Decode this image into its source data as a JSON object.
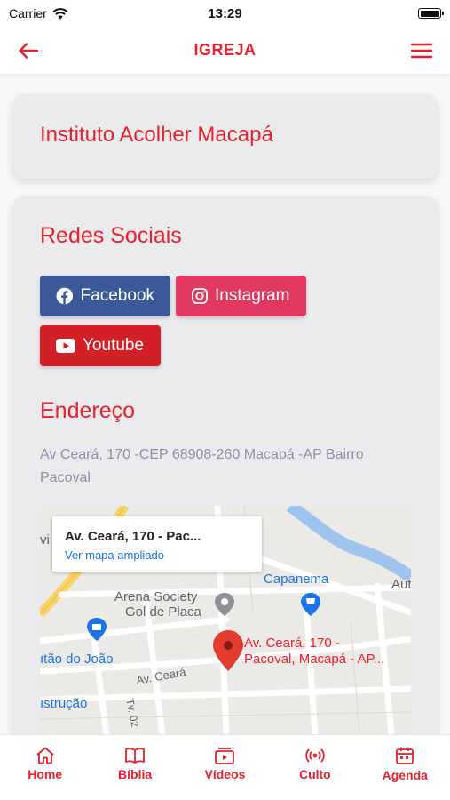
{
  "status": {
    "carrier": "Carrier",
    "time": "13:29"
  },
  "nav": {
    "title": "IGREJA",
    "back_icon": "arrow-left-icon",
    "menu_icon": "hamburger-menu-icon"
  },
  "church": {
    "name": "Instituto Acolher Macapá"
  },
  "social": {
    "title": "Redes Sociais",
    "facebook_label": "Facebook",
    "instagram_label": "Instagram",
    "youtube_label": "Youtube"
  },
  "address": {
    "title": "Endereço",
    "text": "Av Ceará, 170 -CEP 68908-260 Macapá -AP Bairro Pacoval"
  },
  "map": {
    "popup_title": "Av. Ceará, 170 - Pac...",
    "popup_link": "Ver mapa ampliado",
    "labels": {
      "vi": "vi",
      "capanema": "Capanema",
      "aut": "Aut",
      "arena1": "Arena Society",
      "arena2": "Gol de Placa",
      "joao": "ıtão do João",
      "pin1": "Av. Ceará, 170 -",
      "pin2": "Pacoval, Macapá -  AP...",
      "street": "Av. Ceará",
      "construcao": "ıstrução",
      "tv": "Tv. 02"
    }
  },
  "tabs": [
    {
      "label": "Home",
      "icon": "home-icon"
    },
    {
      "label": "Bíblia",
      "icon": "book-icon"
    },
    {
      "label": "Vídeos",
      "icon": "video-icon"
    },
    {
      "label": "Culto",
      "icon": "broadcast-icon"
    },
    {
      "label": "Agenda",
      "icon": "calendar-icon"
    }
  ],
  "colors": {
    "accent": "#e8212d",
    "facebook": "#3b5998",
    "instagram": "#e1395f",
    "youtube": "#d32027",
    "address_text": "#8d8faa"
  }
}
